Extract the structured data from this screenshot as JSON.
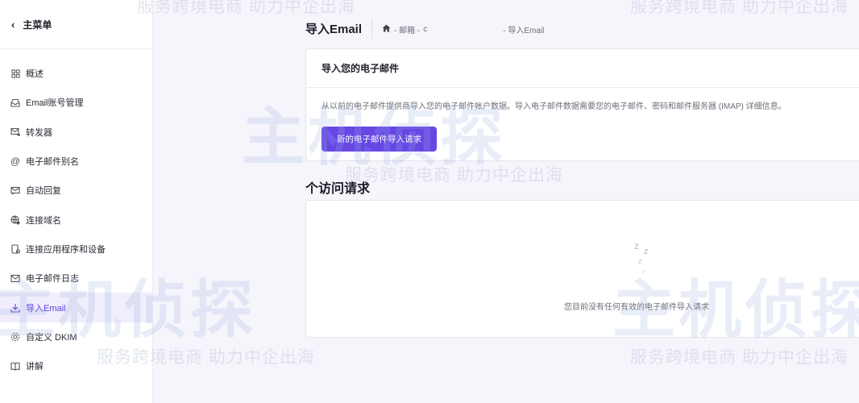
{
  "sidebar": {
    "back_label": "主菜单",
    "items": [
      {
        "label": "概述",
        "icon": "grid-icon"
      },
      {
        "label": "Email账号管理",
        "icon": "inbox-icon"
      },
      {
        "label": "转发器",
        "icon": "forward-mail-icon"
      },
      {
        "label": "电子邮件别名",
        "icon": "at-icon"
      },
      {
        "label": "自动回复",
        "icon": "auto-reply-icon"
      },
      {
        "label": "连接域名",
        "icon": "globe-link-icon"
      },
      {
        "label": "连接应用程序和设备",
        "icon": "device-icon"
      },
      {
        "label": "电子邮件日志",
        "icon": "mail-log-icon"
      },
      {
        "label": "导入Email",
        "icon": "download-icon",
        "active": true
      },
      {
        "label": "自定义 DKIM",
        "icon": "gear-icon"
      },
      {
        "label": "讲解",
        "icon": "book-icon"
      }
    ]
  },
  "header": {
    "title": "导入Email",
    "breadcrumb_mid": "- 邮箱 - ",
    "breadcrumb_partial": "c",
    "breadcrumb_end": "- 导入Email"
  },
  "import_card": {
    "title": "导入您的电子邮件",
    "description": "从以前的电子邮件提供商导入您的电子邮件帐户数据。导入电子邮件数据需要您的电子邮件、密码和邮件服务器 (IMAP) 详细信息。",
    "button_label": "新的电子邮件导入请求"
  },
  "requests": {
    "section_title": "个访问请求",
    "empty_text": "您目前没有任何有效的电子邮件导入请求"
  },
  "watermark": {
    "brand": "主机侦探",
    "slogan": "服务跨境电商 助力中企出海"
  },
  "colors": {
    "accent": "#6747e4",
    "active_bg": "#f1eefc"
  }
}
